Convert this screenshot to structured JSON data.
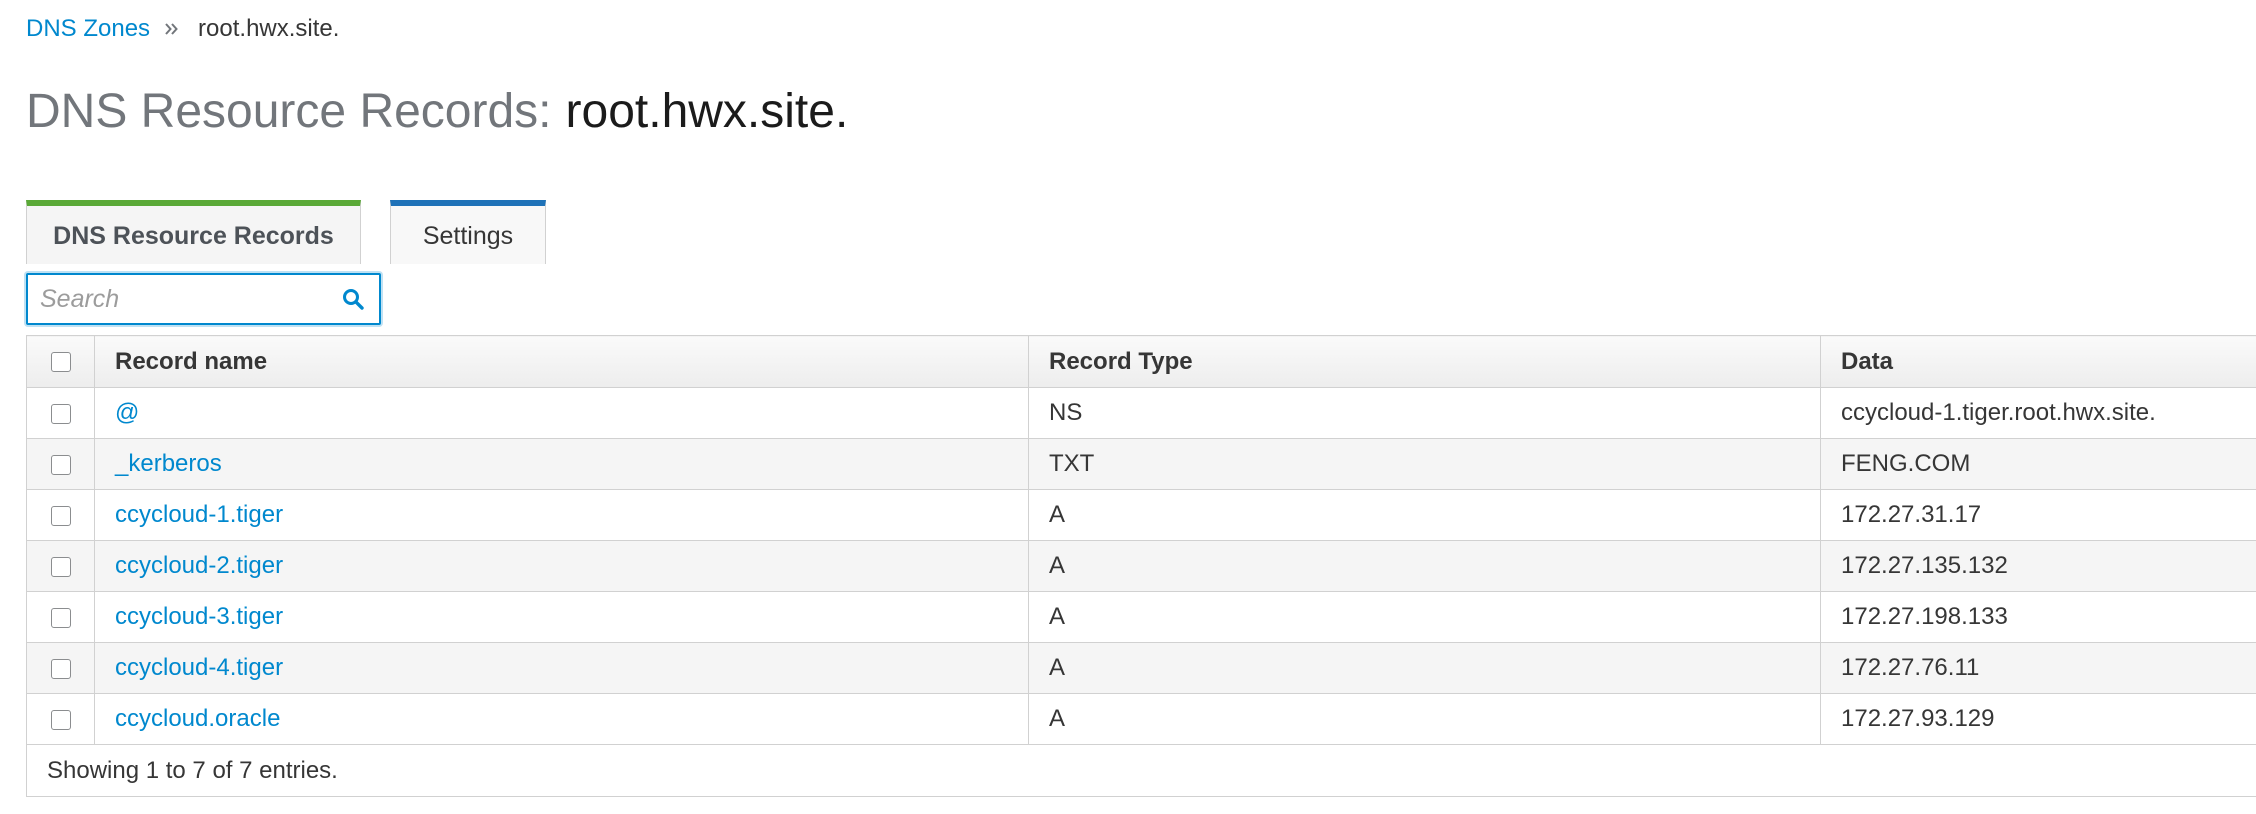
{
  "breadcrumb": {
    "parent_label": "DNS Zones",
    "current_label": "root.hwx.site."
  },
  "title": {
    "prefix": "DNS Resource Records:",
    "zone": "root.hwx.site."
  },
  "tabs": [
    {
      "label": "DNS Resource Records",
      "active": true
    },
    {
      "label": "Settings",
      "active": false
    }
  ],
  "search": {
    "placeholder": "Search",
    "value": ""
  },
  "table": {
    "columns": [
      "Record name",
      "Record Type",
      "Data"
    ],
    "rows": [
      {
        "name": "@",
        "type": "NS",
        "data": "ccycloud-1.tiger.root.hwx.site."
      },
      {
        "name": "_kerberos",
        "type": "TXT",
        "data": "FENG.COM"
      },
      {
        "name": "ccycloud-1.tiger",
        "type": "A",
        "data": "172.27.31.17"
      },
      {
        "name": "ccycloud-2.tiger",
        "type": "A",
        "data": "172.27.135.132"
      },
      {
        "name": "ccycloud-3.tiger",
        "type": "A",
        "data": "172.27.198.133"
      },
      {
        "name": "ccycloud-4.tiger",
        "type": "A",
        "data": "172.27.76.11"
      },
      {
        "name": "ccycloud.oracle",
        "type": "A",
        "data": "172.27.93.129"
      }
    ],
    "footer": "Showing 1 to 7 of 7 entries."
  },
  "colors": {
    "link": "#0088ce",
    "active_tab_accent": "#5aa937",
    "inactive_tab_accent": "#1f72b8",
    "title_prefix": "#72767b"
  },
  "icons": {
    "breadcrumb_separator": "double-chevron-right-icon",
    "search": "search-icon"
  }
}
